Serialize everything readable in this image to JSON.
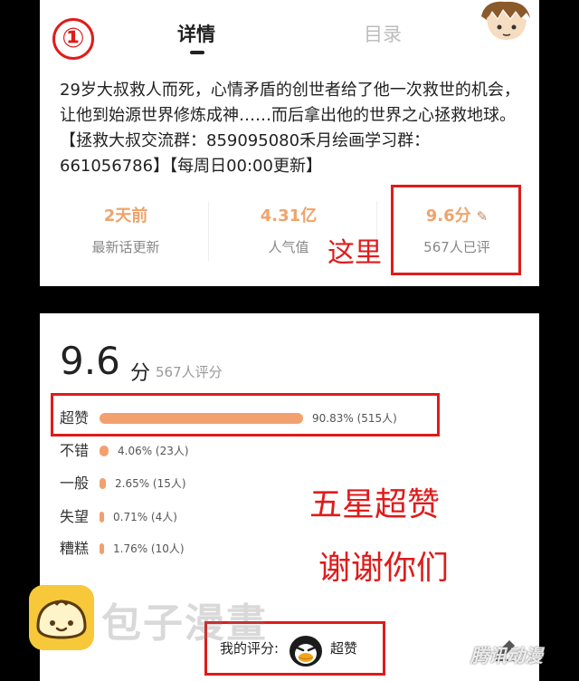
{
  "annotation": {
    "step_marker": "①",
    "note_here": "这里",
    "note_five_star": "五星超赞",
    "note_thanks": "谢谢你们"
  },
  "tabs": {
    "detail": "详情",
    "catalog": "目录"
  },
  "description": "29岁大叔救人而死，心情矛盾的创世者给了他一次救世的机会，让他到始源世界修炼成神……而后拿出他的世界之心拯救地球。【拯救大叔交流群：859095080禾月绘画学习群：661056786】【每周日00:00更新】",
  "stats": [
    {
      "value": "2天前",
      "label": "最新话更新"
    },
    {
      "value": "4.31亿",
      "label": "人气值"
    },
    {
      "value": "9.6分",
      "label": "567人已评",
      "icon": "pencil-icon"
    }
  ],
  "rating": {
    "score": "9.6",
    "unit": "分",
    "count_text": "567人评分",
    "rows": [
      {
        "label": "超赞",
        "stat": "90.83% (515人)",
        "percent": 90.83
      },
      {
        "label": "不错",
        "stat": "4.06% (23人)",
        "percent": 4.06
      },
      {
        "label": "一般",
        "stat": "2.65% (15人)",
        "percent": 2.65
      },
      {
        "label": "失望",
        "stat": "0.71% (4人)",
        "percent": 0.71
      },
      {
        "label": "糟糕",
        "stat": "1.76% (10人)",
        "percent": 1.76
      }
    ],
    "my_score_label": "我的评分:",
    "my_score_value": "超赞",
    "my_score_icon": "penguin-face-icon",
    "edit_icon": "pencil-icon"
  },
  "branding": {
    "logo_icon": "bun-logo-icon",
    "site_name": "包子漫畫",
    "watermark": "腾讯动漫"
  },
  "colors": {
    "accent_orange": "#f3a06f",
    "annotation_red": "#e01b1b",
    "logo_yellow": "#f7c83a"
  }
}
